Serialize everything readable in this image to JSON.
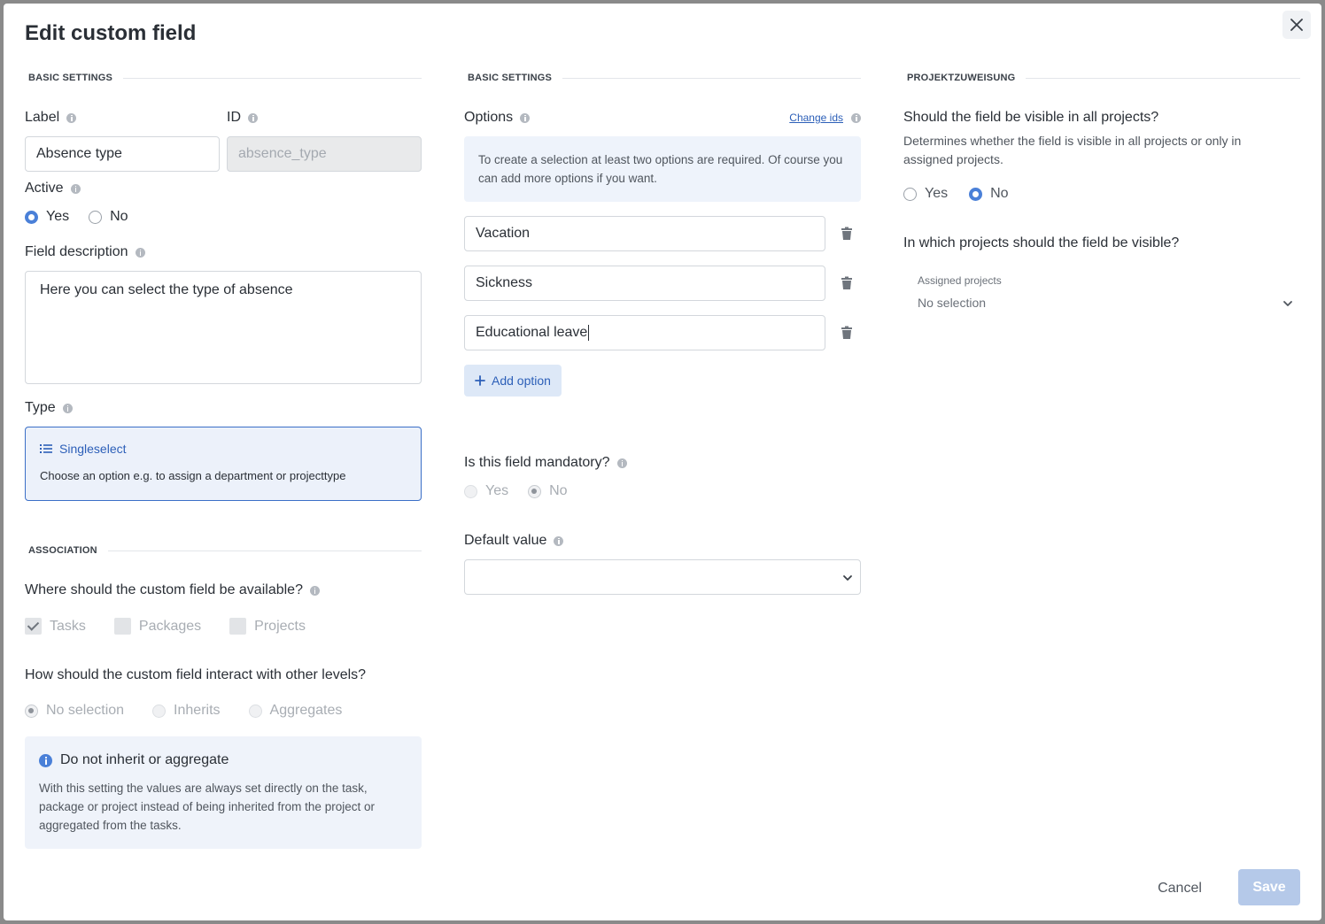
{
  "dialog": {
    "title": "Edit custom field",
    "cancel_label": "Cancel",
    "save_label": "Save"
  },
  "basic_settings_left": {
    "heading": "BASIC SETTINGS",
    "label_label": "Label",
    "label_value": "Absence type",
    "id_label": "ID",
    "id_value": "absence_type",
    "active_label": "Active",
    "active_yes": "Yes",
    "active_no": "No",
    "active_selected": "Yes",
    "description_label": "Field description",
    "description_value": "Here you can select the type of absence",
    "type_label": "Type",
    "type_name": "Singleselect",
    "type_desc": "Choose an option e.g. to assign a department or projecttype"
  },
  "association": {
    "heading": "ASSOCIATION",
    "where_label": "Where should the custom field be available?",
    "checks": [
      {
        "label": "Tasks",
        "checked": true
      },
      {
        "label": "Packages",
        "checked": false
      },
      {
        "label": "Projects",
        "checked": false
      }
    ],
    "interact_label": "How should the custom field interact with other levels?",
    "interact_options": [
      "No selection",
      "Inherits",
      "Aggregates"
    ],
    "interact_selected": "No selection",
    "box_title": "Do not inherit or aggregate",
    "box_text": "With this setting the values are always set directly on the task, package or project instead of being inherited from the project or aggregated from the tasks."
  },
  "basic_settings_mid": {
    "heading": "BASIC SETTINGS",
    "options_label": "Options",
    "change_ids": "Change ids",
    "hint": "To create a selection at least two options are required. Of course you can add more options if you want.",
    "options": [
      "Vacation",
      "Sickness",
      "Educational leave"
    ],
    "add_option": "Add option",
    "mandatory_label": "Is this field mandatory?",
    "mandatory_yes": "Yes",
    "mandatory_no": "No",
    "mandatory_selected": "No",
    "default_label": "Default value",
    "default_value": ""
  },
  "project_assignment": {
    "heading": "PROJEKTZUWEISUNG",
    "visible_all_label": "Should the field be visible in all projects?",
    "visible_all_desc": "Determines whether the field is visible in all projects or only in assigned projects.",
    "yes": "Yes",
    "no": "No",
    "selected": "No",
    "which_label": "In which projects should the field be visible?",
    "assigned_label": "Assigned projects",
    "assigned_value": "No selection"
  },
  "colors": {
    "accent": "#4a80d8",
    "save_disabled": "#b5c9e9",
    "type_card_border": "#3b6fc7"
  }
}
